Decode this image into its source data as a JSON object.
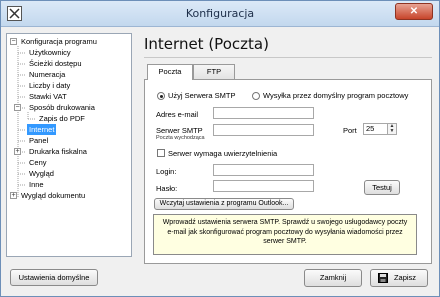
{
  "window": {
    "title": "Konfiguracja",
    "close_label": "✕"
  },
  "tree": {
    "items": [
      {
        "label": "Konfiguracja programu"
      },
      {
        "label": "Użytkownicy"
      },
      {
        "label": "Ścieżki dostępu"
      },
      {
        "label": "Numeracja"
      },
      {
        "label": "Liczby i daty"
      },
      {
        "label": "Stawki VAT"
      },
      {
        "label": "Sposób drukowania"
      },
      {
        "label": "Zapis do PDF"
      },
      {
        "label": "Internet"
      },
      {
        "label": "Panel"
      },
      {
        "label": "Drukarka fiskalna"
      },
      {
        "label": "Ceny"
      },
      {
        "label": "Wygląd"
      },
      {
        "label": "Inne"
      },
      {
        "label": "Wygląd dokumentu"
      }
    ],
    "selected": "Internet"
  },
  "page": {
    "title": "Internet (Poczta)"
  },
  "tabs": [
    {
      "label": "Poczta",
      "active": true
    },
    {
      "label": "FTP",
      "active": false
    }
  ],
  "mail": {
    "radio_smtp": "Użyj Serwera SMTP",
    "radio_default": "Wysyłka przez domyślny program pocztowy",
    "email_label": "Adres e-mail",
    "email_value": "",
    "smtp_label": "Serwer SMTP",
    "smtp_sublabel": "Poczta wychodząca",
    "smtp_value": "",
    "port_label": "Port",
    "port_value": "25",
    "auth_label": "Serwer wymaga uwierzytelnienia",
    "login_label": "Login:",
    "login_value": "",
    "password_label": "Hasło:",
    "password_value": "",
    "test_button": "Testuj",
    "import_button": "Wczytaj ustawienia z programu Outlook...",
    "info_text": "Wprowadź ustawienia serwera SMTP.  Sprawdź u swojego usługodawcy poczty e-mail jak skonfigurować program pocztowy do wysyłania wiadomości przez serwer SMTP."
  },
  "footer": {
    "defaults_button": "Ustawienia domyślne",
    "close_button": "Zamknij",
    "save_button": "Zapisz"
  }
}
